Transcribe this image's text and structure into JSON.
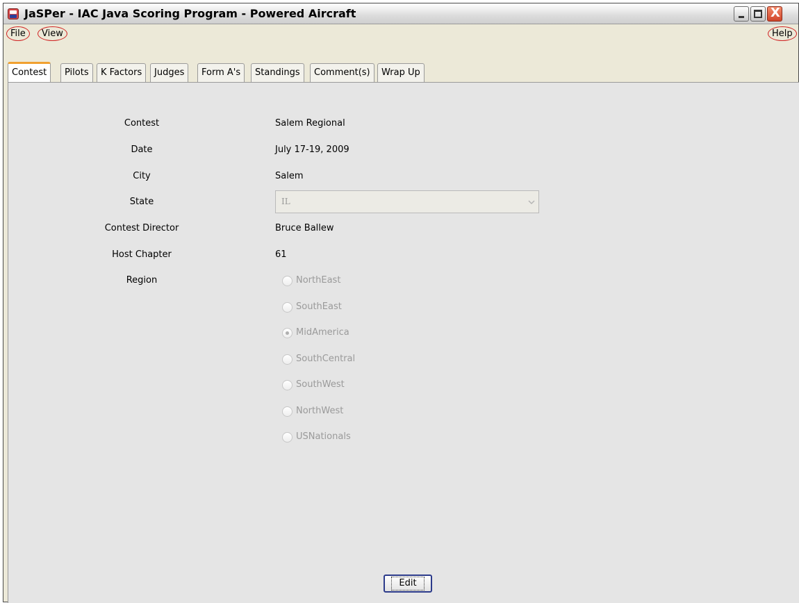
{
  "window": {
    "title": "JaSPer - IAC Java Scoring Program - Powered Aircraft",
    "controls": {
      "minimize": "minimize-icon",
      "maximize": "maximize-icon",
      "close": "close-icon",
      "close_glyph": "X"
    }
  },
  "menu": {
    "file": "File",
    "view": "View",
    "help": "Help"
  },
  "tabs": [
    {
      "label": "Contest",
      "active": true
    },
    {
      "label": "Pilots"
    },
    {
      "label": "K Factors"
    },
    {
      "label": "Judges"
    },
    {
      "label": "Form A's"
    },
    {
      "label": "Standings"
    },
    {
      "label": "Comment(s)"
    },
    {
      "label": "Wrap Up"
    }
  ],
  "form": {
    "contest": {
      "label": "Contest",
      "value": "Salem Regional"
    },
    "date": {
      "label": "Date",
      "value": "July 17-19, 2009"
    },
    "city": {
      "label": "City",
      "value": "Salem"
    },
    "state": {
      "label": "State",
      "value": "IL"
    },
    "director": {
      "label": "Contest Director",
      "value": "Bruce Ballew"
    },
    "chapter": {
      "label": "Host Chapter",
      "value": "61"
    },
    "region": {
      "label": "Region",
      "options": [
        "NorthEast",
        "SouthEast",
        "MidAmerica",
        "SouthCentral",
        "SouthWest",
        "NorthWest",
        "USNationals"
      ],
      "selected": "MidAmerica"
    }
  },
  "buttons": {
    "edit": "Edit"
  },
  "colors": {
    "menu_highlight": "#d02020",
    "active_tab_accent": "#f0a030",
    "panel_bg": "#e5e5e5"
  }
}
